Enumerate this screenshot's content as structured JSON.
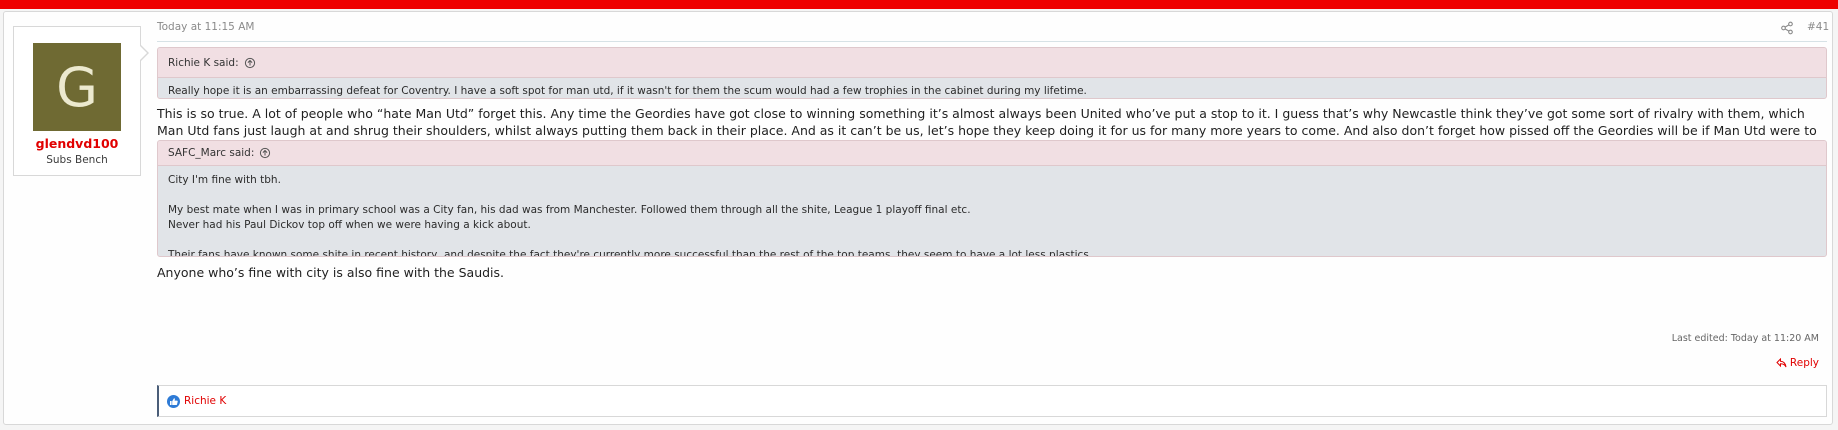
{
  "user": {
    "avatar_letter": "G",
    "username": "glendvd100",
    "title": "Subs Bench",
    "avatar_color": "#6f6a33"
  },
  "post": {
    "date": "Today at 11:15 AM",
    "number": "#41",
    "quotes": [
      {
        "author": "Richie K said:",
        "lines": [
          "Really hope it is an embarrassing defeat for Coventry. I have a soft spot for man utd, if it wasn't for them the scum would had a few trophies in the cabinet during my lifetime."
        ]
      },
      {
        "author": "SAFC_Marc said:",
        "lines": [
          "City I'm fine with tbh.",
          "",
          "My best mate when I was in primary school was a City fan, his dad was from Manchester. Followed them through all the shite, League 1 playoff final etc.",
          "Never had his Paul Dickov top off when we were having a kick about.",
          "",
          "Their fans have known some shite in recent history, and despite the fact they're currently more successful than the rest of the top teams, they seem to have a lot less plastics."
        ]
      }
    ],
    "message_1": "This is so true. A lot of people who “hate Man Utd” forget this. Any time the Geordies have got close to winning something it’s almost always been United who’ve put a stop to it. I guess that’s why Newcastle think they’ve got some sort of rivalry with them, which Man Utd fans just laugh at and shrug their shoulders, whilst always putting them back in their place. And as it can’t be us, let’s hope they keep doing it for us for many more years to come. And also don’t forget how pissed off the Geordies will be if Man Utd were to win the thing. So bonus points purely for that.",
    "message_2": "Anyone who’s fine with city is also fine with the Saudis.",
    "last_edited": "Last edited: Today at 11:20 AM",
    "reply_label": "Reply",
    "likes": "Richie K"
  },
  "icons": {
    "share": "share-icon",
    "quote_jump": "arrow-up-circle-icon",
    "reply": "reply-icon",
    "like": "thumbs-up-icon"
  },
  "colors": {
    "accent": "#e10000",
    "top_bar": "#ee0000"
  }
}
